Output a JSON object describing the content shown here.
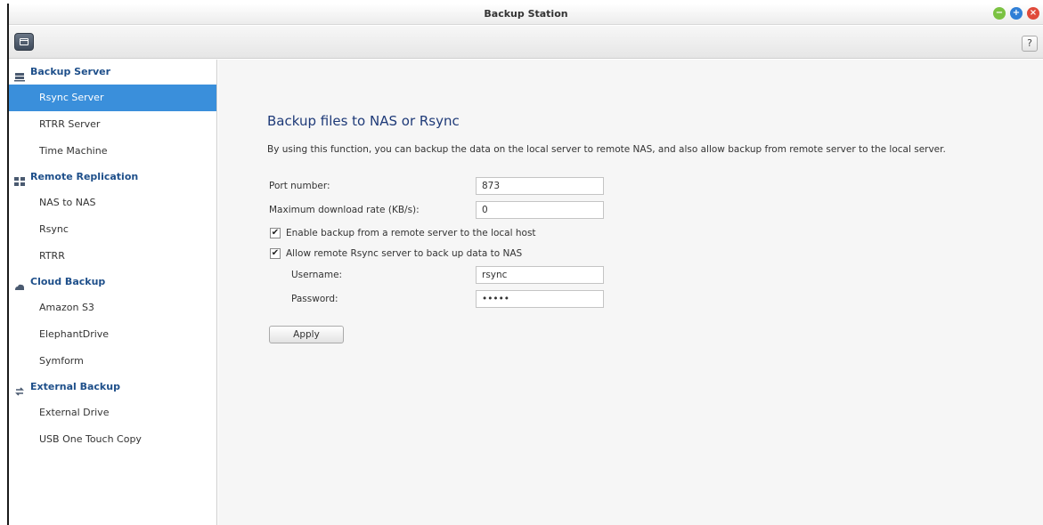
{
  "window": {
    "title": "Backup Station",
    "controls": {
      "minimize": "−",
      "maximize": "+",
      "close": "×"
    }
  },
  "toolbar": {
    "help_label": "?"
  },
  "sidebar": {
    "groups": [
      {
        "label": "Backup Server",
        "icon": "server-icon",
        "items": [
          {
            "label": "Rsync Server",
            "selected": true
          },
          {
            "label": "RTRR Server"
          },
          {
            "label": "Time Machine"
          }
        ]
      },
      {
        "label": "Remote Replication",
        "icon": "replication-icon",
        "items": [
          {
            "label": "NAS to NAS"
          },
          {
            "label": "Rsync"
          },
          {
            "label": "RTRR"
          }
        ]
      },
      {
        "label": "Cloud Backup",
        "icon": "cloud-icon",
        "items": [
          {
            "label": "Amazon S3"
          },
          {
            "label": "ElephantDrive"
          },
          {
            "label": "Symform"
          }
        ]
      },
      {
        "label": "External Backup",
        "icon": "sync-arrows-icon",
        "items": [
          {
            "label": "External Drive"
          },
          {
            "label": "USB One Touch Copy"
          }
        ]
      }
    ]
  },
  "main": {
    "heading": "Backup files to NAS or Rsync",
    "description": "By using this function, you can backup the data on the local server to remote NAS, and also allow backup from remote server to the local server.",
    "port_label": "Port number:",
    "port_value": "873",
    "max_rate_label": "Maximum download rate (KB/s):",
    "max_rate_value": "0",
    "enable_backup_label": "Enable backup from a remote server to the local host",
    "enable_backup_checked": true,
    "allow_remote_label": "Allow remote Rsync server to back up data to NAS",
    "allow_remote_checked": true,
    "username_label": "Username:",
    "username_value": "rsync",
    "password_label": "Password:",
    "password_value": "•••••",
    "apply_label": "Apply",
    "check_glyph": "✔"
  },
  "colors": {
    "accent": "#3a8fdb",
    "group_header": "#1e4f8a",
    "heading": "#1e3a78"
  }
}
